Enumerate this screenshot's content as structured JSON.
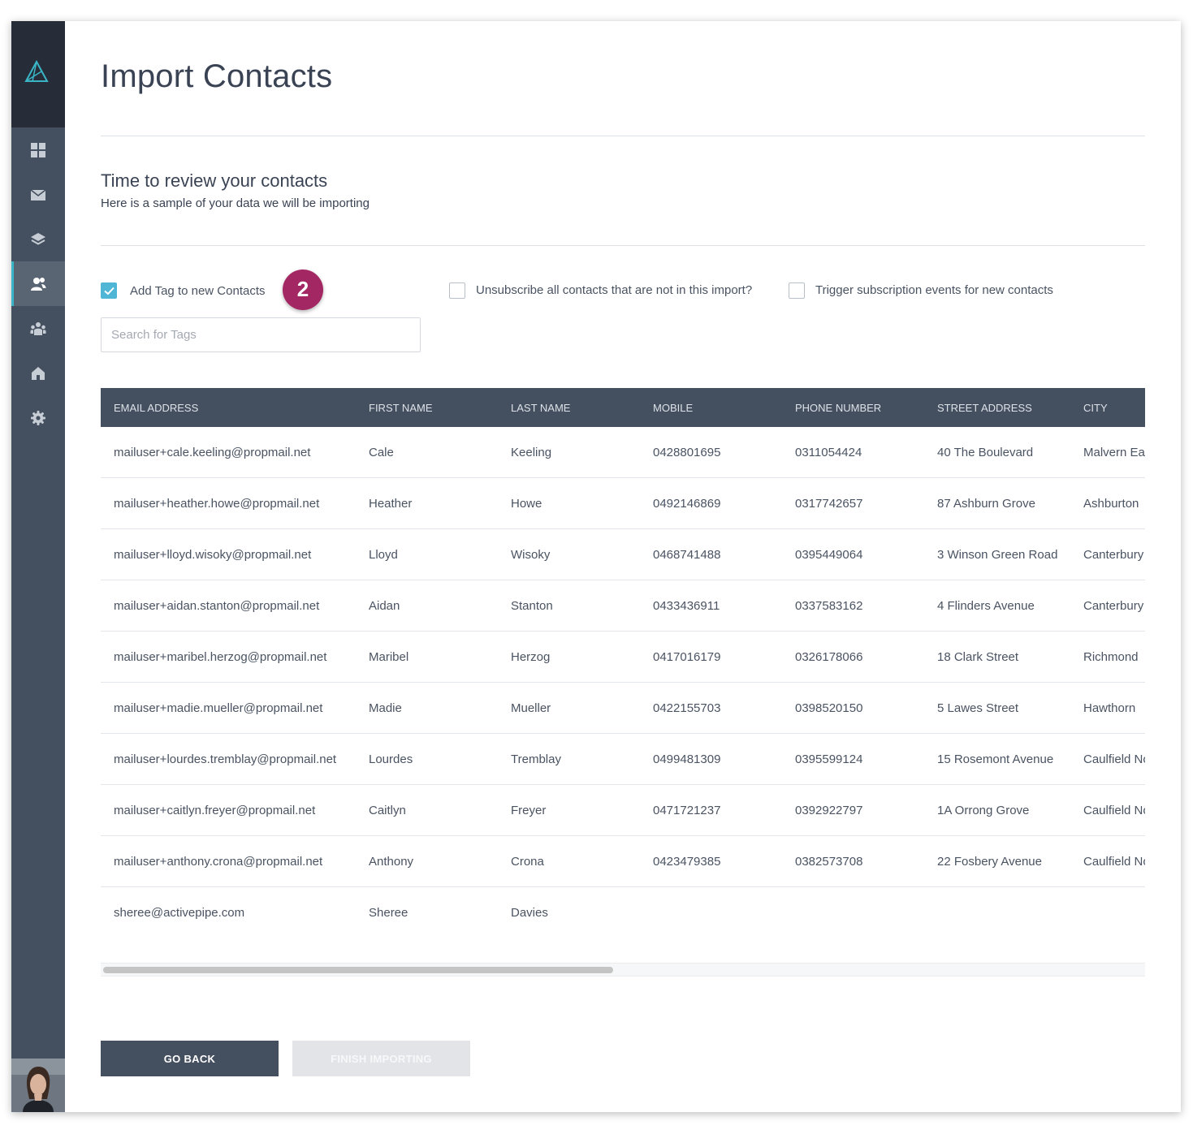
{
  "colors": {
    "sidebar": "#444f5f",
    "sidebar_dark": "#262c38",
    "accent": "#3ab5c6",
    "checkbox": "#4fb6d6",
    "badge": "#a32763"
  },
  "sidebar": {
    "logo": "logo-icon",
    "items": [
      {
        "icon": "dashboard-icon"
      },
      {
        "icon": "mail-icon"
      },
      {
        "icon": "layers-icon"
      },
      {
        "icon": "contacts-icon",
        "active": true
      },
      {
        "icon": "groups-icon"
      },
      {
        "icon": "home-icon"
      },
      {
        "icon": "gear-icon"
      }
    ]
  },
  "page": {
    "title": "Import Contacts",
    "section_title": "Time to review your contacts",
    "section_subtitle": "Here is a sample of your data we will be importing"
  },
  "options": {
    "add_tag": {
      "label": "Add Tag to new Contacts",
      "checked": true
    },
    "badge": "2",
    "unsubscribe": {
      "label": "Unsubscribe all contacts that are not in this import?",
      "checked": false
    },
    "trigger": {
      "label": "Trigger subscription events for new contacts",
      "checked": false
    },
    "tag_search_placeholder": "Search for Tags"
  },
  "table": {
    "columns": [
      "EMAIL ADDRESS",
      "FIRST NAME",
      "LAST NAME",
      "MOBILE",
      "PHONE NUMBER",
      "STREET ADDRESS",
      "CITY"
    ],
    "rows": [
      [
        "mailuser+cale.keeling@propmail.net",
        "Cale",
        "Keeling",
        "0428801695",
        "0311054424",
        "40 The Boulevard",
        "Malvern East"
      ],
      [
        "mailuser+heather.howe@propmail.net",
        "Heather",
        "Howe",
        "0492146869",
        "0317742657",
        "87 Ashburn Grove",
        "Ashburton"
      ],
      [
        "mailuser+lloyd.wisoky@propmail.net",
        "Lloyd",
        "Wisoky",
        "0468741488",
        "0395449064",
        "3 Winson Green Road",
        "Canterbury"
      ],
      [
        "mailuser+aidan.stanton@propmail.net",
        "Aidan",
        "Stanton",
        "0433436911",
        "0337583162",
        "4 Flinders Avenue",
        "Canterbury"
      ],
      [
        "mailuser+maribel.herzog@propmail.net",
        "Maribel",
        "Herzog",
        "0417016179",
        "0326178066",
        "18 Clark Street",
        "Richmond"
      ],
      [
        "mailuser+madie.mueller@propmail.net",
        "Madie",
        "Mueller",
        "0422155703",
        "0398520150",
        "5 Lawes Street",
        "Hawthorn"
      ],
      [
        "mailuser+lourdes.tremblay@propmail.net",
        "Lourdes",
        "Tremblay",
        "0499481309",
        "0395599124",
        "15 Rosemont Avenue",
        "Caulfield North"
      ],
      [
        "mailuser+caitlyn.freyer@propmail.net",
        "Caitlyn",
        "Freyer",
        "0471721237",
        "0392922797",
        "1A Orrong Grove",
        "Caulfield North"
      ],
      [
        "mailuser+anthony.crona@propmail.net",
        "Anthony",
        "Crona",
        "0423479385",
        "0382573708",
        "22 Fosbery Avenue",
        "Caulfield North"
      ],
      [
        "sheree@activepipe.com",
        "Sheree",
        "Davies",
        "",
        "",
        "",
        ""
      ]
    ]
  },
  "scroll": {
    "horizontal_position": 0
  },
  "buttons": {
    "go_back": "GO BACK",
    "finish": "FINISH IMPORTING"
  }
}
